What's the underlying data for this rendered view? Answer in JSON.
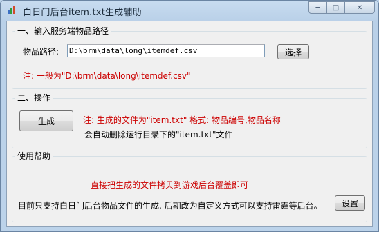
{
  "window": {
    "title": "白日门后台item.txt生成辅助",
    "controls": {
      "minimize": "─",
      "maximize": "□",
      "close": "✕"
    }
  },
  "group1": {
    "title": "一、输入服务端物品路径",
    "path_label": "物品路径:",
    "path_value": "D:\\brm\\data\\long\\itemdef.csv",
    "select_button": "选择",
    "note": "注: 一般为\"D:\\brm\\data\\long\\itemdef.csv\""
  },
  "group2": {
    "title": "二、操作",
    "generate_button": "生成",
    "note_line1": "注: 生成的文件为\"item.txt\"  格式: 物品编号,物品名称",
    "note_line2": "会自动删除运行目录下的\"item.txt\"文件"
  },
  "group3": {
    "title": "使用帮助",
    "help_red": "直接把生成的文件拷贝到游戏后台覆盖即可",
    "help_text": "目前只支持白日门后台物品文件的生成, 后期改为自定义方式可以支持雷霆等后台。",
    "settings_button": "设置"
  },
  "colors": {
    "note_red": "#cc0000",
    "title_bar": "#bcd3ea",
    "client_bg": "#f0f0f0"
  }
}
